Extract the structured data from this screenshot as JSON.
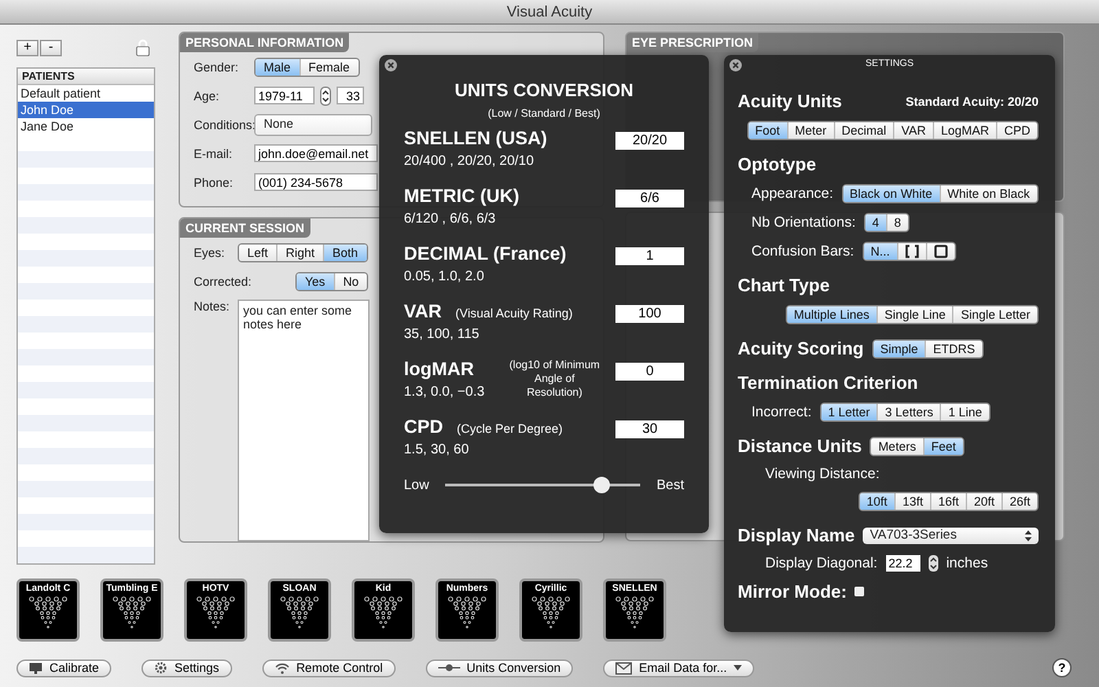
{
  "window": {
    "title": "Visual Acuity"
  },
  "patients": {
    "add": "+",
    "remove": "-",
    "header": "PATIENTS",
    "items": [
      {
        "name": "Default patient",
        "selected": false
      },
      {
        "name": "John Doe",
        "selected": true
      },
      {
        "name": "Jane Doe",
        "selected": false
      }
    ]
  },
  "personal_information": {
    "title": "PERSONAL INFORMATION",
    "gender": {
      "label": "Gender:",
      "options": [
        {
          "label": "Male",
          "selected": true
        },
        {
          "label": "Female",
          "selected": false
        }
      ]
    },
    "age": {
      "label": "Age:",
      "value": "1979-11",
      "years": "33"
    },
    "conditions": {
      "label": "Conditions:",
      "value": "None"
    },
    "email": {
      "label": "E-mail:",
      "value": "john.doe@email.net"
    },
    "phone": {
      "label": "Phone:",
      "value": "(001) 234-5678"
    }
  },
  "current_session": {
    "title": "CURRENT SESSION",
    "eyes": {
      "label": "Eyes:",
      "options": [
        {
          "label": "Left",
          "selected": false
        },
        {
          "label": "Right",
          "selected": false
        },
        {
          "label": "Both",
          "selected": true
        }
      ]
    },
    "corrected": {
      "label": "Corrected:",
      "options": [
        {
          "label": "Yes",
          "selected": true
        },
        {
          "label": "No",
          "selected": false
        }
      ]
    },
    "notes": {
      "label": "Notes:",
      "value": "you can enter some notes here"
    }
  },
  "eye_prescription": {
    "title": "EYE PRESCRIPTION"
  },
  "units_conversion": {
    "title": "UNITS CONVERSION",
    "subtitle": "(Low / Standard / Best)",
    "rows": [
      {
        "name": "SNELLEN (USA)",
        "values": "20/400 , 20/20, 20/10",
        "value": "20/20"
      },
      {
        "name": "METRIC (UK)",
        "values": "6/120 , 6/6, 6/3",
        "value": "6/6"
      },
      {
        "name": "DECIMAL (France)",
        "values": "0.05, 1.0, 2.0",
        "value": "1"
      },
      {
        "name": "VAR",
        "note": "(Visual Acuity Rating)",
        "values": "35, 100, 115",
        "value": "100"
      },
      {
        "name": "logMAR",
        "note": "(log10 of Minimum Angle of Resolution)",
        "values": "1.3, 0.0, −0.3",
        "value": "0"
      },
      {
        "name": "CPD",
        "note": "(Cycle Per Degree)",
        "values": "1.5, 30, 60",
        "value": "30"
      }
    ],
    "slider": {
      "low": "Low",
      "high": "Best",
      "level": 0.8
    }
  },
  "settings": {
    "title": "SETTINGS",
    "rows": [
      {
        "kind": "heading",
        "text": "Acuity Units",
        "note": "Standard Acuity: 20/20"
      },
      {
        "kind": "segments",
        "options": [
          {
            "label": "Foot",
            "selected": true
          },
          {
            "label": "Meter",
            "selected": false
          },
          {
            "label": "Decimal",
            "selected": false
          },
          {
            "label": "VAR",
            "selected": false
          },
          {
            "label": "LogMAR",
            "selected": false
          },
          {
            "label": "CPD",
            "selected": false
          }
        ]
      },
      {
        "kind": "heading",
        "text": "Optotype"
      },
      {
        "kind": "field",
        "label": "Appearance:",
        "options": [
          {
            "label": "Black on White",
            "selected": true
          },
          {
            "label": "White on Black",
            "selected": false
          }
        ]
      },
      {
        "kind": "field",
        "label": "Nb Orientations:",
        "options": [
          {
            "label": "4",
            "selected": true
          },
          {
            "label": "8",
            "selected": false
          }
        ]
      },
      {
        "kind": "field",
        "label": "Confusion Bars:",
        "options": [
          {
            "label": "N...",
            "selected": true
          },
          {
            "kind": "bars",
            "selected": false
          },
          {
            "kind": "box",
            "selected": false
          }
        ]
      },
      {
        "kind": "heading",
        "text": "Chart Type"
      },
      {
        "kind": "segments",
        "options": [
          {
            "label": "Multiple Lines",
            "selected": true
          },
          {
            "label": "Single Line",
            "selected": false
          },
          {
            "label": "Single Letter",
            "selected": false
          }
        ]
      },
      {
        "kind": "heading",
        "text": "Acuity Scoring",
        "options": [
          {
            "label": "Simple",
            "selected": true
          },
          {
            "label": "ETDRS",
            "selected": false
          }
        ]
      },
      {
        "kind": "heading",
        "text": "Termination Criterion"
      },
      {
        "kind": "field",
        "label": "Incorrect:",
        "options": [
          {
            "label": "1 Letter",
            "selected": true
          },
          {
            "label": "3 Letters",
            "selected": false
          },
          {
            "label": "1 Line",
            "selected": false
          }
        ]
      },
      {
        "kind": "heading",
        "text": "Distance Units",
        "options": [
          {
            "label": "Meters",
            "selected": false
          },
          {
            "label": "Feet",
            "selected": true
          }
        ]
      },
      {
        "kind": "label",
        "text": "Viewing Distance:"
      },
      {
        "kind": "segments",
        "options": [
          {
            "label": "10ft",
            "selected": true
          },
          {
            "label": "13ft",
            "selected": false
          },
          {
            "label": "16ft",
            "selected": false
          },
          {
            "label": "20ft",
            "selected": false
          },
          {
            "label": "26ft",
            "selected": false
          }
        ]
      },
      {
        "kind": "heading",
        "text": "Display Name",
        "select": "VA703-3Series"
      },
      {
        "kind": "number",
        "label": "Display Diagonal:",
        "value": "22.2",
        "unit": "inches"
      },
      {
        "kind": "checkbox",
        "label": "Mirror Mode:",
        "checked": false
      }
    ]
  },
  "charts": [
    {
      "title": "Landolt C"
    },
    {
      "title": "Tumbling E"
    },
    {
      "title": "HOTV"
    },
    {
      "title": "SLOAN"
    },
    {
      "title": "Kid"
    },
    {
      "title": "Numbers"
    },
    {
      "title": "Cyrillic"
    },
    {
      "title": "SNELLEN"
    }
  ],
  "toolbar": [
    {
      "kind": "monitor",
      "label": "Calibrate"
    },
    {
      "kind": "gear",
      "label": "Settings"
    },
    {
      "kind": "wireless",
      "label": "Remote Control"
    },
    {
      "kind": "slider",
      "label": "Units Conversion"
    },
    {
      "kind": "email",
      "label": "Email Data for..."
    }
  ],
  "help": "?"
}
